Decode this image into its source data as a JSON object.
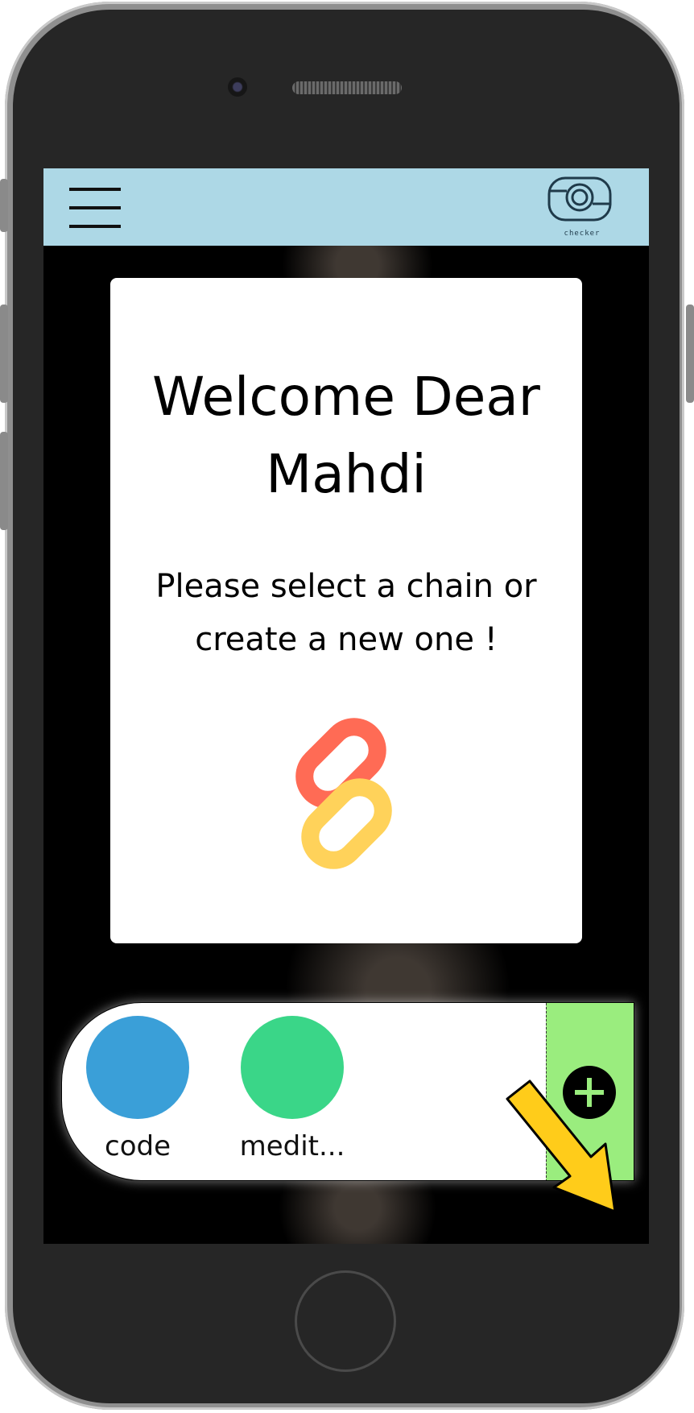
{
  "header": {
    "logo_text": "checker",
    "colors": {
      "background": "#add8e6"
    }
  },
  "welcome_card": {
    "title_line1": "Welcome Dear",
    "title_line2": "Mahdi",
    "subtitle_line1": "Please select a chain or",
    "subtitle_line2": "create a new one !",
    "icon": "chain-link-icon",
    "icon_colors": [
      "#ff6b55",
      "#ffd25a"
    ]
  },
  "chains": [
    {
      "label": "code",
      "color": "#3a9fd8"
    },
    {
      "label": "medit...",
      "color": "#3ad688"
    }
  ],
  "add_chain": {
    "icon": "plus-icon",
    "panel_color": "#9aed7e"
  },
  "annotation": {
    "icon": "arrow-icon",
    "color": "#ffcc1a"
  }
}
